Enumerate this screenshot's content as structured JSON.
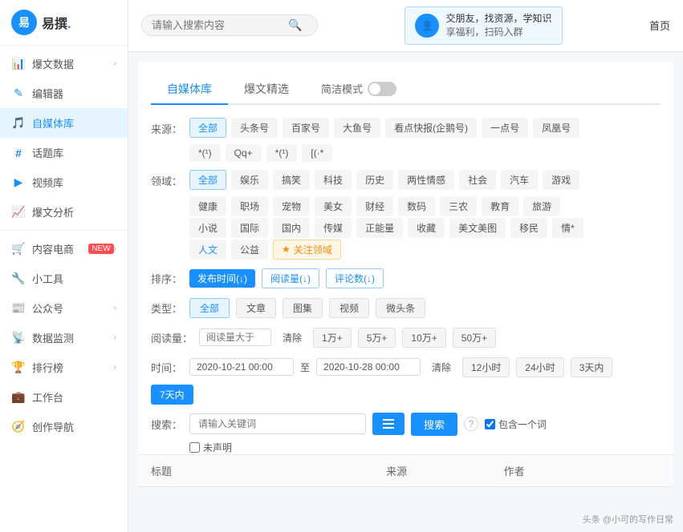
{
  "logo": {
    "icon_text": "易",
    "name": "易撰",
    "dot": "."
  },
  "header": {
    "search_placeholder": "请输入搜索内容",
    "banner_line1": "交朋友，找资源，学知识",
    "banner_line2": "享福利，扫码入群",
    "nav_home": "首页"
  },
  "sidebar": {
    "items": [
      {
        "id": "baowen-data",
        "label": "爆文数据",
        "icon": "📊",
        "has_arrow": true
      },
      {
        "id": "bianji",
        "label": "编辑器",
        "icon": "✏️",
        "has_arrow": false
      },
      {
        "id": "zimeiti",
        "label": "自媒体库",
        "icon": "🎵",
        "has_arrow": false,
        "active": true
      },
      {
        "id": "huati",
        "label": "话题库",
        "icon": "#",
        "has_arrow": false
      },
      {
        "id": "shipin",
        "label": "视频库",
        "icon": "▶",
        "has_arrow": false
      },
      {
        "id": "baowen-fenxi",
        "label": "爆文分析",
        "icon": "📈",
        "has_arrow": false
      },
      {
        "id": "neirong-diansang",
        "label": "内容电商",
        "icon": "🛒",
        "badge": "NEW",
        "has_arrow": true
      },
      {
        "id": "xiao-gongju",
        "label": "小工具",
        "icon": "🔧",
        "has_arrow": false
      },
      {
        "id": "gongzhonghao",
        "label": "公众号",
        "icon": "📰",
        "has_arrow": true
      },
      {
        "id": "shuju-jiankong",
        "label": "数据监测",
        "icon": "📡",
        "has_arrow": true
      },
      {
        "id": "paihang",
        "label": "排行榜",
        "icon": "🏆",
        "has_arrow": true
      },
      {
        "id": "gongzuotai",
        "label": "工作台",
        "icon": "💼",
        "has_arrow": false
      },
      {
        "id": "chuangzuo-daohang",
        "label": "创作导航",
        "icon": "🧭",
        "has_arrow": false
      }
    ]
  },
  "tabs": [
    {
      "id": "zimeiti-tiku",
      "label": "自媒体库",
      "active": true
    },
    {
      "id": "baowen-jingxuan",
      "label": "爆文精选",
      "active": false
    },
    {
      "id": "jianjie-moshi",
      "label": "简洁模式",
      "is_toggle": true
    }
  ],
  "filters": {
    "source_label": "来源：",
    "source_tags": [
      {
        "id": "all",
        "label": "全部",
        "active": true
      },
      {
        "id": "toutiao",
        "label": "头条号",
        "active": false
      },
      {
        "id": "baijiahao",
        "label": "百家号",
        "active": false
      },
      {
        "id": "dayu",
        "label": "大鱼号",
        "active": false
      },
      {
        "id": "kandian",
        "label": "看点快报(企鹅号)",
        "active": false
      },
      {
        "id": "yidian",
        "label": "一点号",
        "active": false
      },
      {
        "id": "fenghuang",
        "label": "凤凰号",
        "active": false
      },
      {
        "id": "wangyi",
        "label": "*(¹)",
        "active": false
      },
      {
        "id": "qq",
        "label": "Qq+",
        "active": false
      },
      {
        "id": "weixin",
        "label": "*(¹)",
        "active": false
      },
      {
        "id": "bilibili",
        "label": "[(·*",
        "active": false
      }
    ],
    "domain_label": "领域：",
    "domain_tags": [
      {
        "id": "all",
        "label": "全部",
        "active": true
      },
      {
        "id": "yule",
        "label": "娱乐",
        "active": false
      },
      {
        "id": "gaoxiao",
        "label": "搞笑",
        "active": false
      },
      {
        "id": "keji",
        "label": "科技",
        "active": false
      },
      {
        "id": "lishi",
        "label": "历史",
        "active": false
      },
      {
        "id": "liangxing",
        "label": "两性情感",
        "active": false
      },
      {
        "id": "shehui",
        "label": "社会",
        "active": false
      },
      {
        "id": "qiche",
        "label": "汽车",
        "active": false
      },
      {
        "id": "youxi",
        "label": "游戏",
        "active": false
      },
      {
        "id": "jiankang",
        "label": "健康",
        "active": false
      },
      {
        "id": "zhichang",
        "label": "职场",
        "active": false
      },
      {
        "id": "chongwu",
        "label": "宠物",
        "active": false
      },
      {
        "id": "meinv",
        "label": "美女",
        "active": false
      },
      {
        "id": "caijing",
        "label": "财经",
        "active": false
      },
      {
        "id": "shuma",
        "label": "数码",
        "active": false
      },
      {
        "id": "sannong",
        "label": "三农",
        "active": false
      },
      {
        "id": "jiaoyu",
        "label": "教育",
        "active": false
      },
      {
        "id": "lvyou",
        "label": "旅游",
        "active": false
      },
      {
        "id": "xiaoshuo",
        "label": "小说",
        "active": false
      },
      {
        "id": "guoji",
        "label": "国际",
        "active": false
      },
      {
        "id": "guonei",
        "label": "国内",
        "active": false
      },
      {
        "id": "chuanmei",
        "label": "传媒",
        "active": false
      },
      {
        "id": "zhengneng",
        "label": "正能量",
        "active": false
      },
      {
        "id": "shoucang",
        "label": "收藏",
        "active": false
      },
      {
        "id": "meiwenmeitou",
        "label": "美文美图",
        "active": false
      },
      {
        "id": "yimin",
        "label": "移民",
        "active": false
      },
      {
        "id": "other1",
        "label": "情*",
        "active": false
      },
      {
        "id": "renwen",
        "label": "人文",
        "active": false,
        "highlight": true
      },
      {
        "id": "gongyi",
        "label": "公益",
        "active": false
      }
    ],
    "follow_domain_label": "关注领域",
    "sort_label": "排序：",
    "sort_options": [
      {
        "id": "publish-time",
        "label": "发布时间(↓)",
        "active": true
      },
      {
        "id": "read-count",
        "label": "阅读量(↓)",
        "active": false
      },
      {
        "id": "comment-count",
        "label": "评论数(↓)",
        "active": false
      }
    ],
    "type_label": "类型：",
    "type_options": [
      {
        "id": "all",
        "label": "全部",
        "active": true
      },
      {
        "id": "article",
        "label": "文章",
        "active": false
      },
      {
        "id": "gallery",
        "label": "图集",
        "active": false
      },
      {
        "id": "video",
        "label": "视频",
        "active": false
      },
      {
        "id": "microhead",
        "label": "微头条",
        "active": false
      }
    ],
    "read_label": "阅读量：",
    "read_placeholder": "阅读量大于",
    "read_clear": "清除",
    "read_options": [
      "1万+",
      "5万+",
      "10万+",
      "50万+"
    ],
    "time_label": "时间：",
    "time_start": "2020-10-21 00:00",
    "time_to": "至",
    "time_end": "2020-10-28 00:00",
    "time_clear": "清除",
    "time_options": [
      {
        "id": "12h",
        "label": "12小时",
        "active": false
      },
      {
        "id": "24h",
        "label": "24小时",
        "active": false
      },
      {
        "id": "3d",
        "label": "3天内",
        "active": false
      },
      {
        "id": "7d",
        "label": "7天内",
        "active": true
      }
    ],
    "search_label": "搜索：",
    "keyword_placeholder": "请输入关键词",
    "search_btn": "搜索",
    "contain_one": "包含一个词",
    "undeclared": "未声明"
  },
  "table": {
    "cols": [
      {
        "id": "title",
        "label": "标题"
      },
      {
        "id": "source",
        "label": "来源"
      },
      {
        "id": "author",
        "label": "作者"
      }
    ]
  },
  "watermark": {
    "text": "头条 @小可的写作日常"
  }
}
